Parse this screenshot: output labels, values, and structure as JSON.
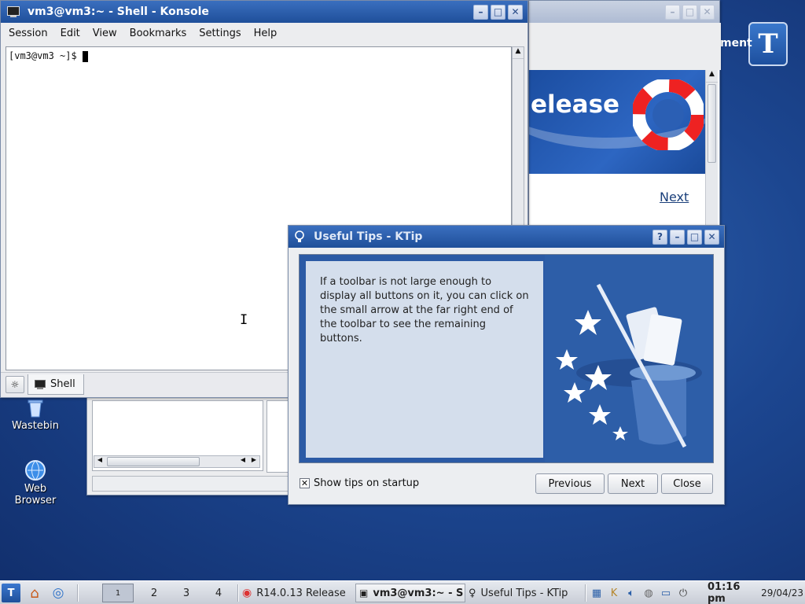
{
  "desktop": {
    "icons": [
      {
        "label": "Wastebin"
      },
      {
        "label_line1": "Web",
        "label_line2": "Browser"
      }
    ],
    "trinity_logo_glyph": "T"
  },
  "browser": {
    "partial_title": "ment",
    "banner_text": "elease",
    "next_link": "Next"
  },
  "konsole": {
    "title": "vm3@vm3:~ - Shell - Konsole",
    "menu": [
      "Session",
      "Edit",
      "View",
      "Bookmarks",
      "Settings",
      "Help"
    ],
    "prompt": "[vm3@vm3 ~]$ ",
    "tab_label": "Shell"
  },
  "ktip": {
    "title": "Useful Tips - KTip",
    "tip_text": "If a toolbar is not large enough to display all buttons on it, you can click on the small arrow at the far right end of the toolbar to see the remaining buttons.",
    "show_tips_label": "Show tips on startup",
    "show_tips_checked": true,
    "buttons": {
      "previous": "Previous",
      "next": "Next",
      "close": "Close"
    }
  },
  "taskbar": {
    "desktops": [
      "1",
      "2",
      "3",
      "4"
    ],
    "tasks": [
      {
        "label": "R14.0.13 Release",
        "icon": "lifebuoy-icon"
      },
      {
        "label": "vm3@vm3:~ - S",
        "icon": "terminal-icon"
      },
      {
        "label": "Useful Tips - KTip",
        "icon": "lightbulb-icon"
      }
    ],
    "clock_time": "01:16 pm",
    "clock_date": "29/04/23"
  },
  "colors": {
    "accent": "#1f4f9a",
    "desktop": "#1c4690",
    "tip_panel": "#d4deec"
  }
}
